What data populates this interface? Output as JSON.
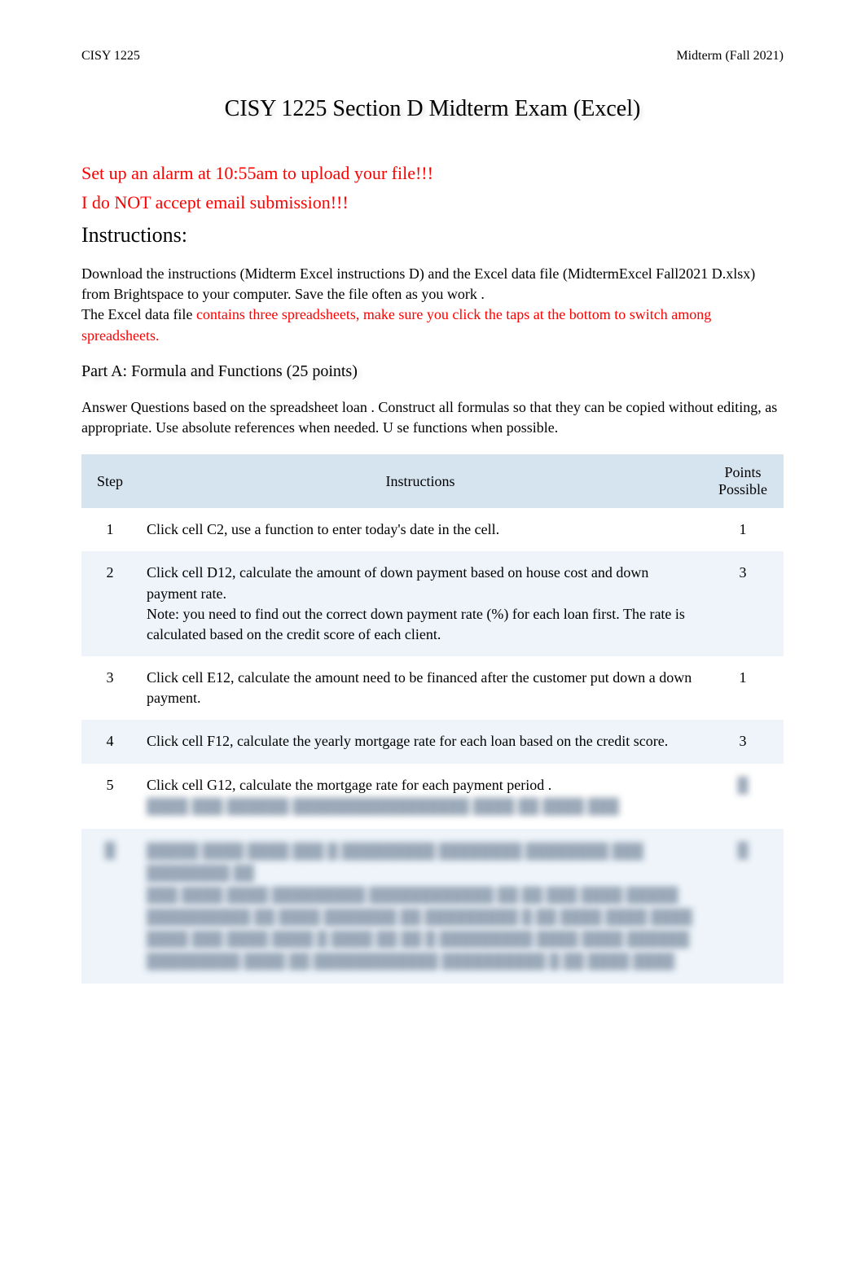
{
  "header": {
    "left": "CISY 1225",
    "right": "Midterm (Fall 2021)"
  },
  "title": "CISY 1225 Section D   Midterm Exam (Excel)",
  "warnings": {
    "line1": "Set up an alarm at 10:55am to upload your file!!!",
    "line2": "I do NOT accept email submission!!!"
  },
  "instructions_heading": "Instructions:",
  "intro": {
    "part1a": "Download the instructions (Midterm Excel instructions D) and the Excel data file (MidtermExcel Fall2021 D.xlsx) from Brightspace to your computer.       ",
    "part1b": "Save the file often as you work   .",
    "part2a": "The Excel data file    ",
    "part2b": "contains   three   spreadsheets, make sure you click the taps at the bottom to switch among spreadsheets."
  },
  "part_a_title": "Part A: Formula and Functions (25 points)",
  "answer_text": "Answer Questions based on the spreadsheet         loan . Construct all formulas so that they can be copied without editing, as appropriate. Use absolute references when needed. U            se  functions when possible.",
  "table": {
    "headers": {
      "step": "Step",
      "instructions": "Instructions",
      "points": "Points Possible"
    },
    "rows": [
      {
        "step": "1",
        "instruction": "Click cell C2, use a function to enter      today's date     in the cell.",
        "points": "1"
      },
      {
        "step": "2",
        "instruction": "Click cell D12, calculate the    amount    of down payment based on house cost and down payment rate.\nNote: you need to find out the correct down payment rate (%) for each loan first. The rate is calculated based on the credit score of each client.",
        "points": "3"
      },
      {
        "step": "3",
        "instruction": "Click cell E12, calculate the amount need to be financed after the customer put down a down payment.",
        "points": "1"
      },
      {
        "step": "4",
        "instruction": "Click cell F12, calculate the    yearly   mortgage rate for each loan based on the credit score.",
        "points": "3"
      },
      {
        "step": "5",
        "instruction_visible": "Click cell G12, calculate the mortgage rate       for each payment period     .",
        "points_blurred": true
      }
    ]
  }
}
